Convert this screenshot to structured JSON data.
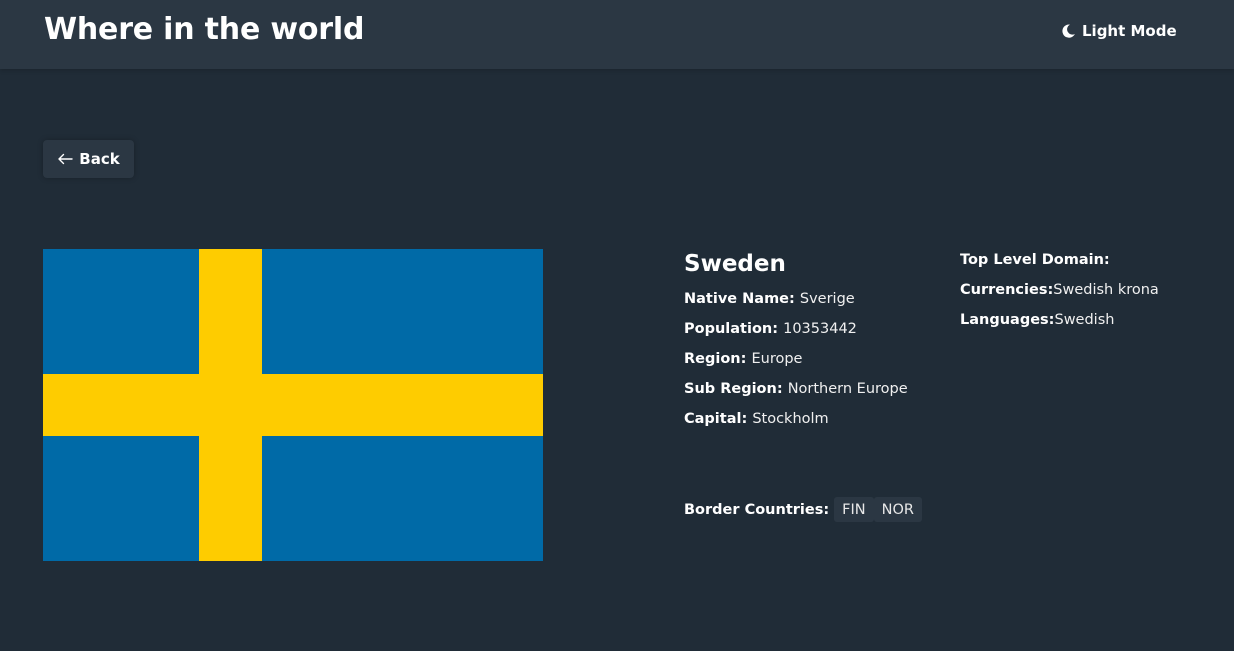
{
  "header": {
    "title": "Where in the world",
    "theme_toggle_label": "Light Mode",
    "theme_icon": "moon-icon"
  },
  "back_button": {
    "label": "Back",
    "icon": "arrow-left-icon"
  },
  "country": {
    "name": "Sweden",
    "flag": {
      "description_icon": "sweden-flag",
      "colors": {
        "field": "#006aa7",
        "cross": "#fecc00"
      }
    },
    "details_left": [
      {
        "label": "Native Name: ",
        "value": "Sverige"
      },
      {
        "label": "Population: ",
        "value": "10353442"
      },
      {
        "label": "Region: ",
        "value": "Europe"
      },
      {
        "label": "Sub Region: ",
        "value": "Northern Europe"
      },
      {
        "label": "Capital: ",
        "value": "Stockholm"
      }
    ],
    "details_right": [
      {
        "label": "Top Level Domain: ",
        "value": ""
      },
      {
        "label": "Currencies:",
        "value": "Swedish krona"
      },
      {
        "label": "Languages:",
        "value": "Swedish"
      }
    ],
    "border_countries": {
      "label": "Border Countries: ",
      "items": [
        "FIN",
        "NOR"
      ]
    }
  },
  "colors": {
    "background": "#202c37",
    "surface": "#2b3743",
    "text": "#ffffff"
  }
}
